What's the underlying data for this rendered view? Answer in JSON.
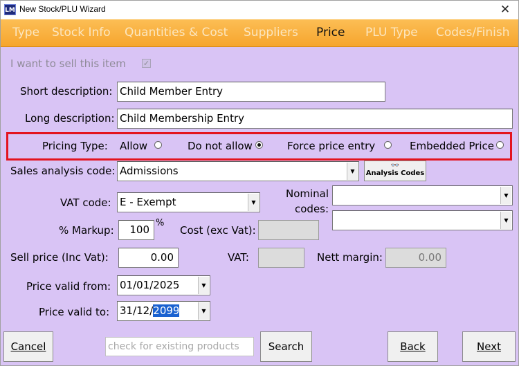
{
  "window": {
    "title": "New Stock/PLU Wizard",
    "app_icon": "LM",
    "close": "✕"
  },
  "tabs": [
    {
      "label": "Type",
      "active": false
    },
    {
      "label": "Stock Info",
      "active": false
    },
    {
      "label": "Quantities & Cost",
      "active": false
    },
    {
      "label": "Suppliers",
      "active": false
    },
    {
      "label": "Price",
      "active": true
    },
    {
      "label": "PLU Type",
      "active": false
    },
    {
      "label": "Codes/Finish",
      "active": false
    }
  ],
  "form": {
    "sell_item_label": "I want to sell this item",
    "sell_item_checked": true,
    "short_desc_label": "Short description:",
    "short_desc_value": "Child Member Entry",
    "long_desc_label": "Long description:",
    "long_desc_value": "Child Membership Entry",
    "pricing_type_label": "Pricing Type:",
    "pricing_options": [
      {
        "label": "Allow",
        "selected": false
      },
      {
        "label": "Do not allow",
        "selected": true
      },
      {
        "label": "Force price entry",
        "selected": false
      },
      {
        "label": "Embedded Price",
        "selected": false
      }
    ],
    "sales_analysis_label": "Sales analysis code:",
    "sales_analysis_value": "Admissions",
    "analysis_codes_button": "Analysis Codes",
    "vat_code_label": "VAT code:",
    "vat_code_value": "E - Exempt",
    "nominal_codes_label_1": "Nominal",
    "nominal_codes_label_2": "codes:",
    "nominal_code_1": "",
    "nominal_code_2": "",
    "markup_label": "% Markup:",
    "markup_value": "100",
    "markup_unit": "%",
    "cost_label": "Cost (exc Vat):",
    "cost_value": "",
    "sell_price_label": "Sell price (Inc Vat):",
    "sell_price_value": "0.00",
    "vat_label": "VAT:",
    "vat_value": "",
    "nett_margin_label": "Nett margin:",
    "nett_margin_value": "0.00",
    "valid_from_label": "Price valid from:",
    "valid_from_value": "01/01/2025",
    "valid_to_label": "Price valid to:",
    "valid_to_prefix": "31/12/",
    "valid_to_year": "2099"
  },
  "footer": {
    "cancel": "Cancel",
    "search_placeholder": "check for existing products",
    "search": "Search",
    "back": "Back",
    "next": "Next"
  }
}
